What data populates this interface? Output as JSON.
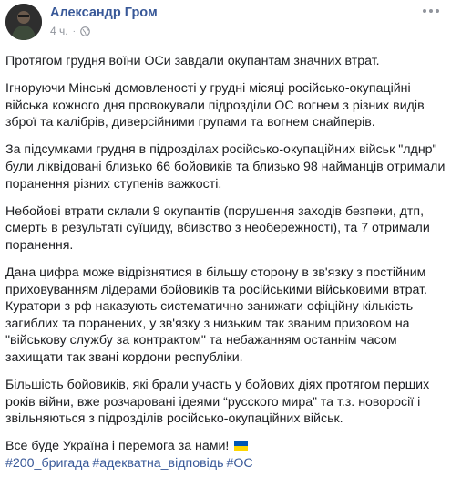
{
  "post": {
    "author": "Александр Гром",
    "time": "4 ч.",
    "separator": "·",
    "privacy_icon": "globe-icon",
    "more_icon": "more-options-icon",
    "paragraphs": [
      "Протягом грудня воїни ОСи завдали окупантам значних втрат.",
      "Ігноруючи Мінські домовленості у грудні місяці російсько-окупаційні війська кожного дня провокували підрозділи ОС вогнем з різних видів зброї та калібрів, диверсійними групами та вогнем снайперів.",
      "За підсумками грудня в підрозділах російсько-окупаційних військ \"лднр\" були ліквідовані близько 66 бойовиків та близько 98 найманців отримали поранення різних ступенів важкості.",
      "Небойові втрати склали 9 окупантів (порушення заходів безпеки, дтп, смерть в результаті суїциду, вбивство з необережності), та 7 отримали поранення.",
      "Дана цифра може відрізнятися в більшу сторону в зв'язку з постійним приховуванням лідерами бойовиків та російськими військовими втрат.",
      "Куратори з рф наказують систематично занижати офіційну кількість загиблих та поранених, у зв'язку з низьким так званим призовом на \"військову службу за контрактом\" та небажанням останнім часом захищати так звані кордони республіки.",
      "Більшість бойовиків, які брали участь у бойових діях протягом перших років війни, вже розчаровані ідеями “русского мира” та т.з. новоросії і звільняються з підрозділів російсько-окупаційних військ.",
      "Все буде Україна і перемога за нами!"
    ],
    "flag_icon": "ukraine-flag-icon",
    "flag_colors": {
      "top": "#0057b7",
      "bottom": "#ffd700"
    },
    "hashtags": [
      "#200_бригада",
      "#адекватна_відповідь",
      "#ОС"
    ]
  },
  "colors": {
    "link": "#385898",
    "text": "#1c1e21",
    "meta": "#90949c"
  }
}
